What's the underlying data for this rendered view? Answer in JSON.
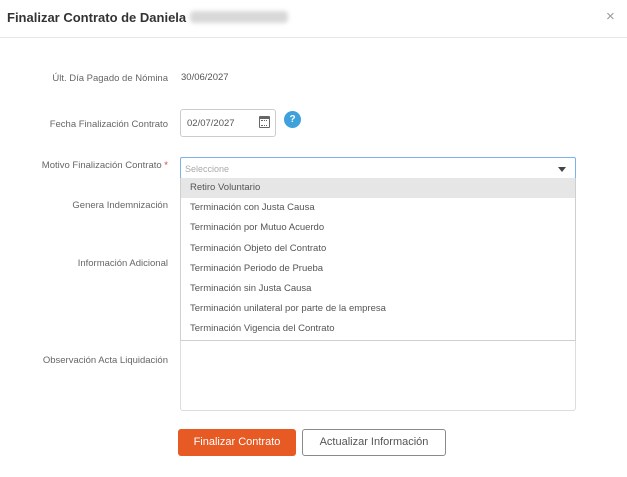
{
  "header": {
    "title": "Finalizar Contrato de Daniela",
    "close_glyph": "×"
  },
  "form": {
    "last_paid_day_label": "Últ. Día Pagado de Nómina",
    "last_paid_day_value": "30/06/2027",
    "end_date_label": "Fecha Finalización Contrato",
    "end_date_value": "02/07/2027",
    "help_glyph": "?",
    "reason_label": "Motivo Finalización Contrato",
    "required_mark": "*",
    "reason_placeholder": "Seleccione",
    "severance_label": "Genera Indemnización",
    "additional_info_label": "Información Adicional",
    "observation_label": "Observación Acta Liquidación"
  },
  "dropdown": {
    "options": [
      "Retiro Voluntario",
      "Terminación con Justa Causa",
      "Terminación por Mutuo Acuerdo",
      "Terminación Objeto del Contrato",
      "Terminación Periodo de Prueba",
      "Terminación sin Justa Causa",
      "Terminación unilateral por parte de la empresa",
      "Terminación Vigencia del Contrato"
    ],
    "highlighted_index": 0
  },
  "actions": {
    "finalize_label": "Finalizar Contrato",
    "update_label": "Actualizar Información"
  },
  "colors": {
    "primary_button": "#e75a24",
    "help_icon": "#3ea1dc",
    "required": "#e0403a"
  }
}
